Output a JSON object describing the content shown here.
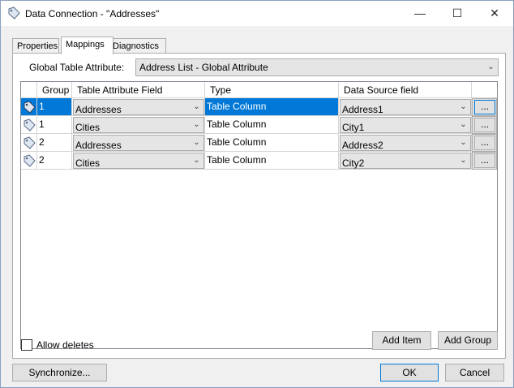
{
  "window": {
    "title": "Data Connection - \"Addresses\"",
    "controls": {
      "minimize": "—",
      "maximize": "☐",
      "close": "✕"
    }
  },
  "tabs": [
    {
      "label": "Properties",
      "active": false
    },
    {
      "label": "Mappings",
      "active": true
    },
    {
      "label": "Diagnostics",
      "active": false
    }
  ],
  "global_table_attribute": {
    "label": "Global Table Attribute:",
    "value": "Address List - Global Attribute"
  },
  "grid": {
    "columns": [
      "",
      "Group",
      "Table Attribute Field",
      "Type",
      "Data Source field",
      ""
    ],
    "rows": [
      {
        "group": "1",
        "field": "Addresses",
        "type": "Table Column",
        "source": "Address1",
        "button": "...",
        "selected": true
      },
      {
        "group": "1",
        "field": "Cities",
        "type": "Table Column",
        "source": "City1",
        "button": "...",
        "selected": false
      },
      {
        "group": "2",
        "field": "Addresses",
        "type": "Table Column",
        "source": "Address2",
        "button": "...",
        "selected": false
      },
      {
        "group": "2",
        "field": "Cities",
        "type": "Table Column",
        "source": "City2",
        "button": "...",
        "selected": false
      }
    ]
  },
  "allow_deletes": {
    "label": "Allow deletes",
    "checked": false
  },
  "buttons": {
    "add_item": "Add Item",
    "add_group": "Add Group",
    "synchronize": "Synchronize...",
    "ok": "OK",
    "cancel": "Cancel"
  },
  "colors": {
    "selection": "#0078d7",
    "accent_border": "#0078d7"
  }
}
